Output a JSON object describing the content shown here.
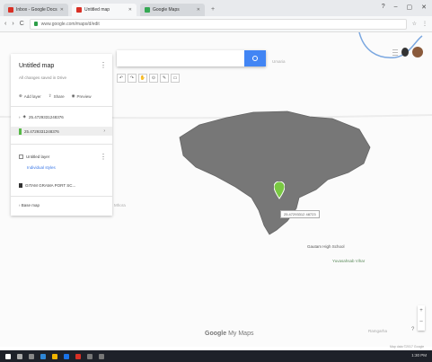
{
  "browser": {
    "tabs": [
      {
        "label": "Inbox - Google Docs",
        "favicon_color": "#d93025",
        "active": false
      },
      {
        "label": "Untitled map",
        "favicon_color": "#d93025",
        "active": true
      },
      {
        "label": "Google Maps",
        "favicon_color": "#34a853",
        "active": false
      }
    ],
    "window_controls": [
      "?",
      "–",
      "▢",
      "✕"
    ],
    "url": "www.google.com/maps/d/edit",
    "nav": {
      "back": "‹",
      "forward": "›",
      "reload": "C"
    }
  },
  "panel": {
    "title": "Untitled map",
    "subtitle": "All changes saved in Drive",
    "actions": [
      "Add layer",
      "Share",
      "Preview"
    ],
    "layers": [
      {
        "label": "25.4729331248376",
        "kind": "collapsed"
      },
      {
        "label": "25.4729331248376",
        "kind": "selected"
      }
    ],
    "untitled_layer": {
      "label": "Untitled layer",
      "style_link": "Individual styles",
      "item": "GITAM GRAMA PORT SC..."
    },
    "base_map": "Base map"
  },
  "search": {
    "placeholder": ""
  },
  "map": {
    "region_fill": "#777777",
    "marker_color": "#7ac943",
    "callout": "25.47293312 48723",
    "labels": {
      "near_search": "Umaria",
      "left_edge": "Mhora",
      "school": "Gautam High School",
      "green_place": "Yuvasahsab Vihar",
      "bottom_right": "Ramgarha"
    }
  },
  "toolbar": [
    "↶",
    "↷",
    "✋",
    "⊙",
    "✎",
    "▭"
  ],
  "footer": {
    "google": "Google",
    "suffix": "My Maps",
    "attribution": "Map data ©2017 Google"
  },
  "taskbar": {
    "clock": "1:30 PM"
  }
}
